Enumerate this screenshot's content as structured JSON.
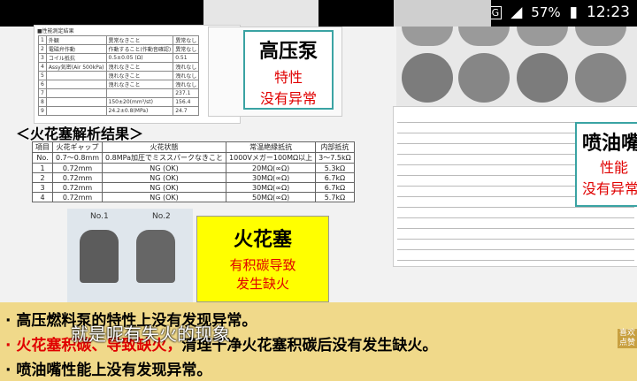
{
  "status_bar": {
    "network": "4G",
    "battery": "57%",
    "time": "12:23"
  },
  "slide": {
    "spec_table_title": "■性能測定結果",
    "spec_rows": [
      [
        "1",
        "外観",
        "異常なきこと",
        "異常なし"
      ],
      [
        "2",
        "電磁弁作動",
        "作動すること(作動音確認)",
        "異常なし"
      ],
      [
        "3",
        "コイル抵抗",
        "0.5±0.05 (Ω)",
        "0.51"
      ],
      [
        "4",
        "Assy気密(Air 500kPa)",
        "洩れなきこと",
        "洩れなし"
      ],
      [
        "5",
        "",
        "洩れなきこと",
        "洩れなし"
      ],
      [
        "6",
        "",
        "洩れなきこと",
        "洩れなし"
      ],
      [
        "7",
        "",
        "",
        "237.1"
      ],
      [
        "8",
        "",
        "150±20(mm³/st)",
        "156.4"
      ],
      [
        "9",
        "",
        "24.2±0.8(MPa)",
        "24.7"
      ]
    ],
    "callout_pump": {
      "title": "高压泵",
      "line1": "特性",
      "line2": "没有异常"
    },
    "spark_heading": "＜火花塞解析结果＞",
    "spark_header": [
      "項目",
      "火花ギャップ",
      "火花状態",
      "常温絶縁抵抗",
      "内部抵抗"
    ],
    "spark_sub": [
      "No.",
      "0.7～0.8mm",
      "0.8MPa加圧でミススパークなきこと",
      "1000Vメガー100MΩ以上",
      "3～7.5kΩ"
    ],
    "spark_rows": [
      [
        "1",
        "0.72mm",
        "NG (OK)",
        "20MΩ(∞Ω)",
        "5.3kΩ"
      ],
      [
        "2",
        "0.72mm",
        "NG (OK)",
        "30MΩ(∞Ω)",
        "6.7kΩ"
      ],
      [
        "3",
        "0.72mm",
        "NG (OK)",
        "30MΩ(∞Ω)",
        "6.7kΩ"
      ],
      [
        "4",
        "0.72mm",
        "NG (OK)",
        "50MΩ(∞Ω)",
        "5.7kΩ"
      ]
    ],
    "plug_label_1": "No.1",
    "plug_label_2": "No.2",
    "callout_spark": {
      "title": "火花塞",
      "line1": "有积碳导致",
      "line2": "发生缺火"
    },
    "callout_injector": {
      "title": "喷油嘴",
      "line1": "性能",
      "line2": "没有异常"
    }
  },
  "bottom": {
    "line1": "· 高压燃料泵的特性上没有发现异常。",
    "line2_red": "· 火花塞积碳、导致缺火，",
    "line2_black": "清理干净火花塞积碳后没有发生缺火。",
    "line3": "· 喷油嘴性能上没有发现异常。",
    "subtitle": "就是呢有失火的现象",
    "corner": "喜欢点赞"
  },
  "colors": {
    "accent_red": "#e00000",
    "callout_border": "#3aa3a3",
    "highlight_yellow": "#ffff00"
  }
}
